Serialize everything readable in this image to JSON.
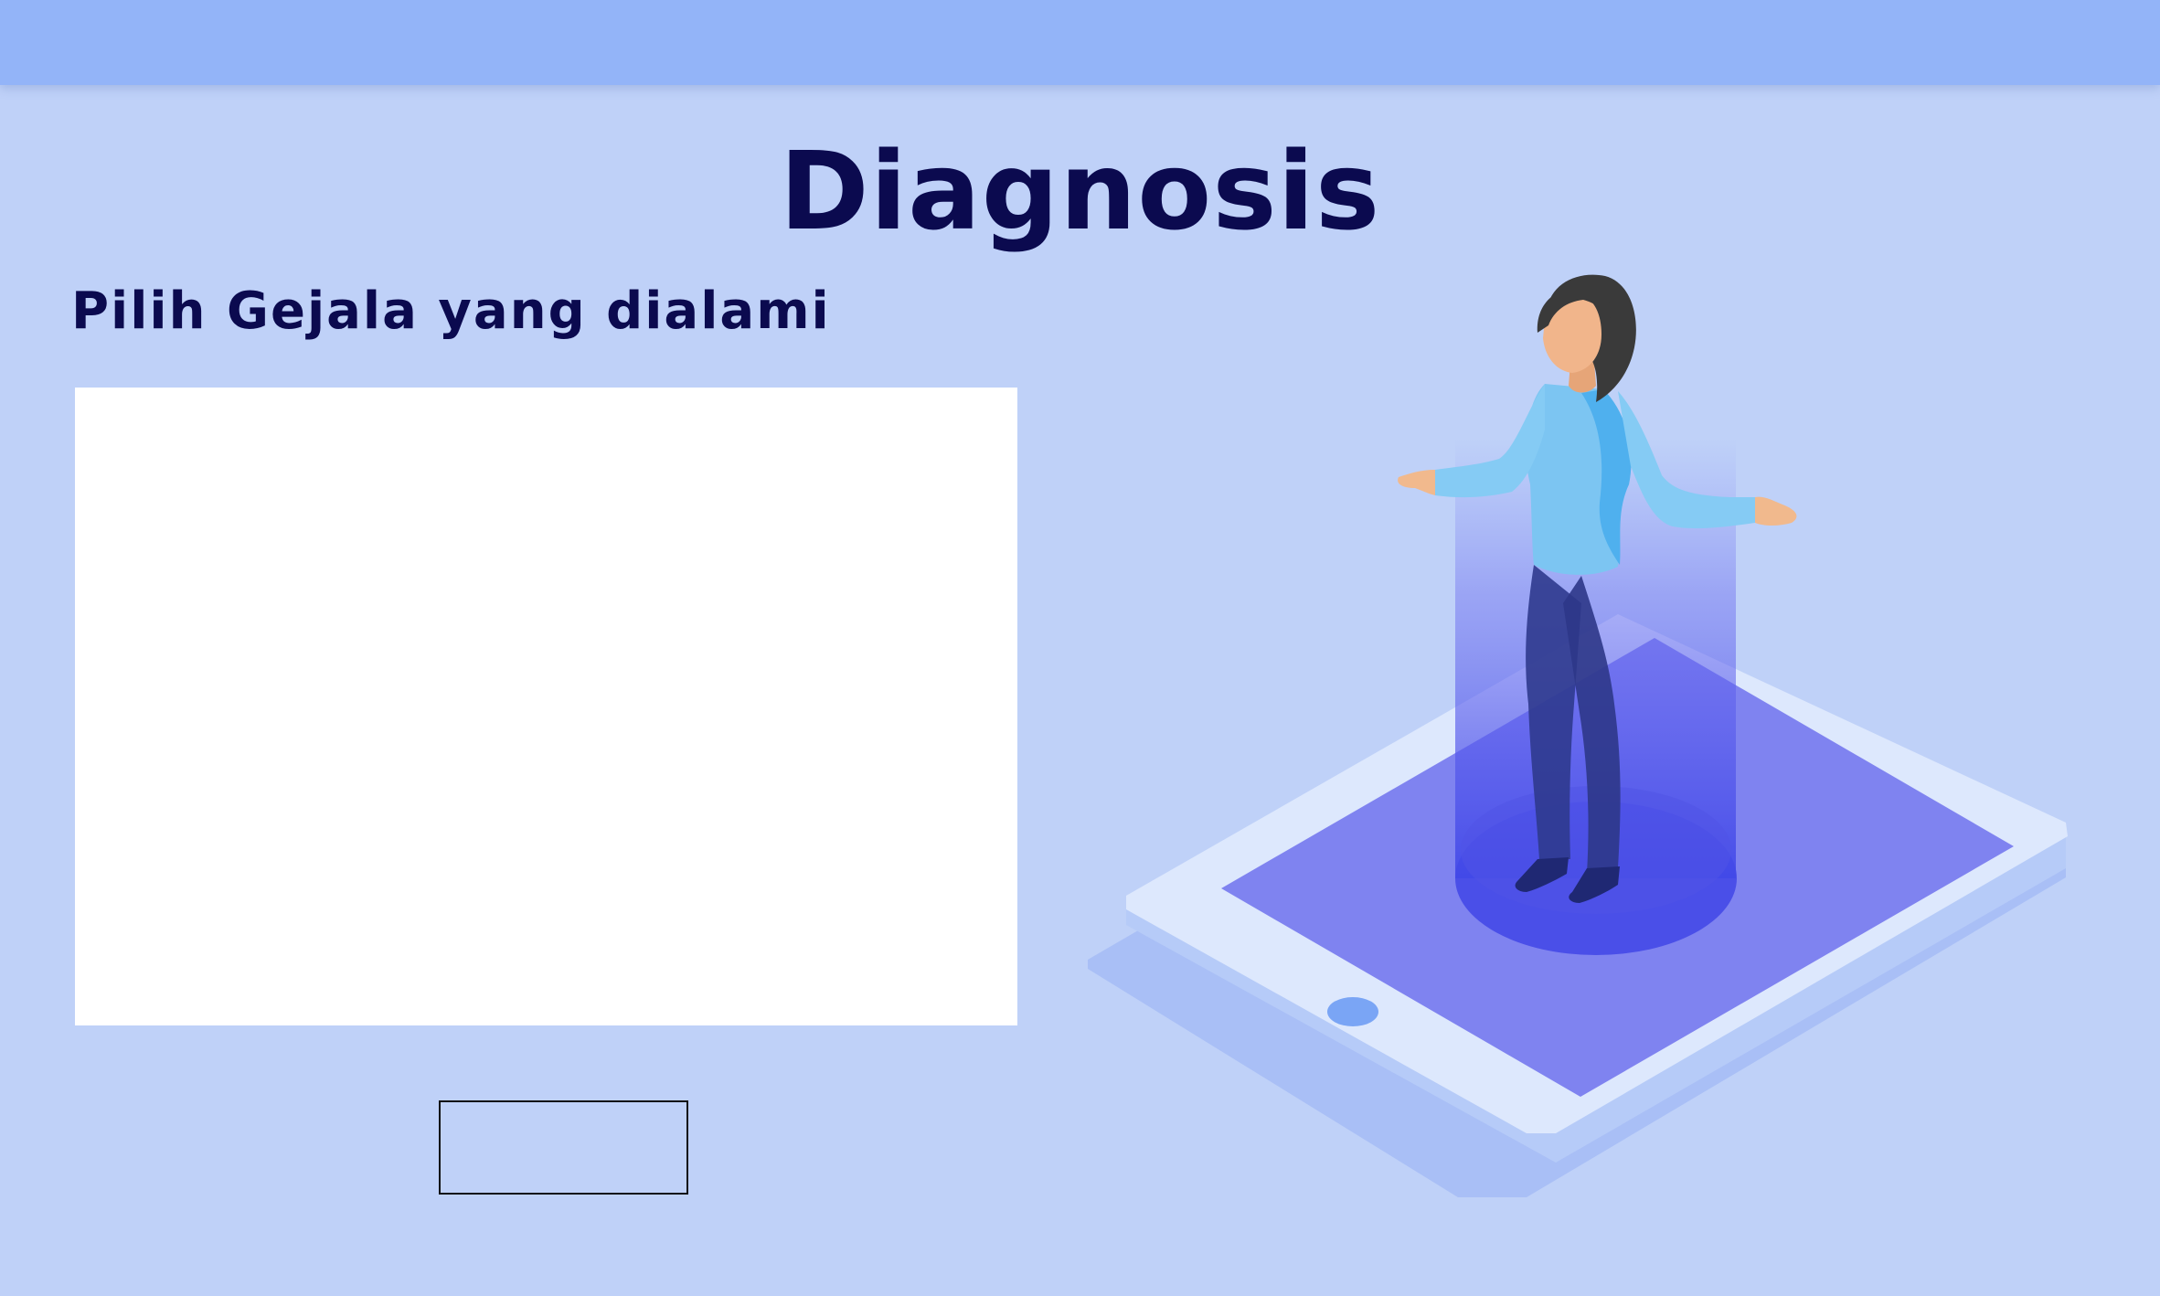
{
  "header": {
    "title": "Diagnosis"
  },
  "main": {
    "subtitle": "Pilih Gejala yang dialami",
    "submit_label": ""
  },
  "illustration": {
    "icon": "person-on-tablet-illustration"
  },
  "colors": {
    "background": "#bfd1f8",
    "top_bar": "#93b4f8",
    "title_text": "#0b0a4f",
    "tablet_screen": "#7f83f0"
  }
}
